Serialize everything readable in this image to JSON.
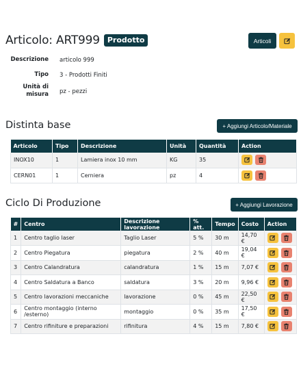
{
  "header": {
    "title": "Articolo: ART999",
    "badge": "Prodotto",
    "articoli_button": "Articoli"
  },
  "details": [
    {
      "label": "Descrizione",
      "value": "articolo 999"
    },
    {
      "label": "Tipo",
      "value": "3 - Prodotti Finiti"
    },
    {
      "label": "Unità di misura",
      "value": "pz - pezzi"
    }
  ],
  "distinta": {
    "title": "Distinta base",
    "add_button": "+ Aggiungi Articolo/Materiale",
    "columns": [
      "Articolo",
      "Tipo",
      "Descrizione",
      "Unità",
      "Quantità",
      "Action"
    ],
    "rows": [
      [
        "INOX10",
        "1",
        "Lamiera inox 10 mm",
        "KG",
        "35"
      ],
      [
        "CERN01",
        "1",
        "Cerniera",
        "pz",
        "4"
      ]
    ]
  },
  "ciclo": {
    "title": "Ciclo Di Produzione",
    "add_button": "+ Aggiungi Lavorazione",
    "columns": [
      "#",
      "Centro",
      "Descrizione lavorazione",
      "% att.",
      "Tempo",
      "Costo",
      "Action"
    ],
    "rows": [
      [
        "1",
        "Centro taglio laser",
        "Taglio Laser",
        "5 %",
        "30 m",
        "14,70 €"
      ],
      [
        "2",
        "Centro Piegatura",
        "piegatura",
        "2 %",
        "40 m",
        "19,04 €"
      ],
      [
        "3",
        "Centro Calandratura",
        "calandratura",
        "1 %",
        "15 m",
        "7,07 €"
      ],
      [
        "4",
        "Centro Saldatura a Banco",
        "saldatura",
        "3 %",
        "20 m",
        "9,96 €"
      ],
      [
        "5",
        "Centro lavorazioni meccaniche",
        "lavorazione",
        "0 %",
        "45 m",
        "22,50 €"
      ],
      [
        "6",
        "Centro montaggio (interno /esterno)",
        "montaggio",
        "0 %",
        "35 m",
        "17,50 €"
      ],
      [
        "7",
        "Centro rifiniture e preparazioni",
        "rifinitura",
        "4 %",
        "15 m",
        "7,80 €"
      ]
    ]
  },
  "colors": {
    "primary": "#0f3b45",
    "warning": "#f6c23e",
    "danger": "#e8826f"
  },
  "icons": {
    "edit": "pencil-square-icon",
    "delete": "trash-icon"
  }
}
